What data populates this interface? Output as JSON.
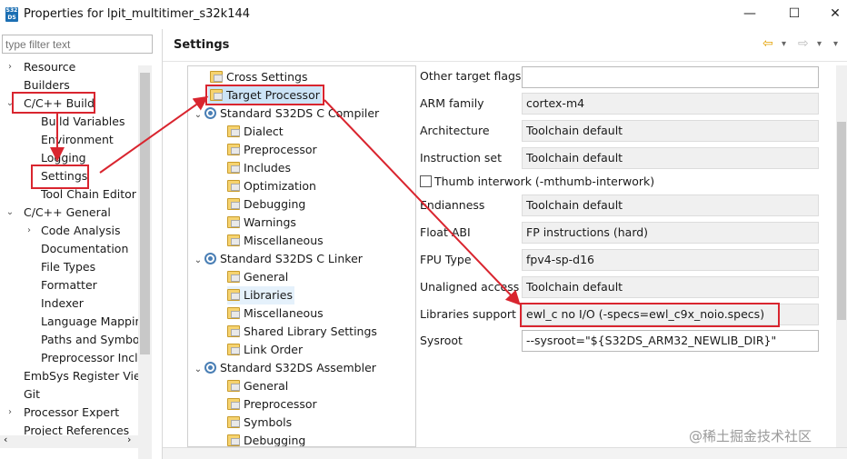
{
  "window": {
    "app_icon_text": "S32 DS",
    "title": "Properties for lpit_multitimer_s32k144",
    "minimize": "—",
    "maximize": "☐",
    "close": "✕"
  },
  "left": {
    "filter_placeholder": "type filter text",
    "items": [
      {
        "label": "Resource",
        "twisty": "›"
      },
      {
        "label": "Builders",
        "twisty": ""
      },
      {
        "label": "C/C++ Build",
        "twisty": "⌄"
      },
      {
        "label": "Build Variables",
        "twisty": ""
      },
      {
        "label": "Environment",
        "twisty": ""
      },
      {
        "label": "Logging",
        "twisty": ""
      },
      {
        "label": "Settings",
        "twisty": ""
      },
      {
        "label": "Tool Chain Editor",
        "twisty": ""
      },
      {
        "label": "C/C++ General",
        "twisty": "⌄"
      },
      {
        "label": "Code Analysis",
        "twisty": "›"
      },
      {
        "label": "Documentation",
        "twisty": ""
      },
      {
        "label": "File Types",
        "twisty": ""
      },
      {
        "label": "Formatter",
        "twisty": ""
      },
      {
        "label": "Indexer",
        "twisty": ""
      },
      {
        "label": "Language Mappin",
        "twisty": ""
      },
      {
        "label": "Paths and Symbols",
        "twisty": ""
      },
      {
        "label": "Preprocessor Inclu",
        "twisty": ""
      },
      {
        "label": "EmbSys Register View",
        "twisty": ""
      },
      {
        "label": "Git",
        "twisty": ""
      },
      {
        "label": "Processor Expert",
        "twisty": "›"
      },
      {
        "label": "Project References",
        "twisty": ""
      }
    ],
    "hscroll_left": "‹",
    "hscroll_right": "›"
  },
  "header": {
    "title": "Settings",
    "back": "⇦",
    "back_dd": "▾",
    "fwd": "⇨",
    "fwd_dd": "▾",
    "menu": "▾"
  },
  "tree": {
    "nodes": [
      {
        "label": "Cross Settings",
        "icon": "folder-settings-icon",
        "twisty": ""
      },
      {
        "label": "Target Processor",
        "icon": "folder-settings-icon",
        "twisty": ""
      },
      {
        "label": "Standard S32DS C Compiler",
        "icon": "tool-icon",
        "twisty": "⌄"
      },
      {
        "label": "Dialect",
        "icon": "folder-settings-icon",
        "twisty": ""
      },
      {
        "label": "Preprocessor",
        "icon": "folder-settings-icon",
        "twisty": ""
      },
      {
        "label": "Includes",
        "icon": "folder-settings-icon",
        "twisty": ""
      },
      {
        "label": "Optimization",
        "icon": "folder-settings-icon",
        "twisty": ""
      },
      {
        "label": "Debugging",
        "icon": "folder-settings-icon",
        "twisty": ""
      },
      {
        "label": "Warnings",
        "icon": "folder-settings-icon",
        "twisty": ""
      },
      {
        "label": "Miscellaneous",
        "icon": "folder-settings-icon",
        "twisty": ""
      },
      {
        "label": "Standard S32DS C Linker",
        "icon": "tool-icon",
        "twisty": "⌄"
      },
      {
        "label": "General",
        "icon": "folder-settings-icon",
        "twisty": ""
      },
      {
        "label": "Libraries",
        "icon": "folder-settings-icon",
        "twisty": ""
      },
      {
        "label": "Miscellaneous",
        "icon": "folder-settings-icon",
        "twisty": ""
      },
      {
        "label": "Shared Library Settings",
        "icon": "folder-settings-icon",
        "twisty": ""
      },
      {
        "label": "Link Order",
        "icon": "folder-settings-icon",
        "twisty": ""
      },
      {
        "label": "Standard S32DS Assembler",
        "icon": "tool-icon",
        "twisty": "⌄"
      },
      {
        "label": "General",
        "icon": "folder-settings-icon",
        "twisty": ""
      },
      {
        "label": "Preprocessor",
        "icon": "folder-settings-icon",
        "twisty": ""
      },
      {
        "label": "Symbols",
        "icon": "folder-settings-icon",
        "twisty": ""
      },
      {
        "label": "Debugging",
        "icon": "folder-settings-icon",
        "twisty": ""
      }
    ]
  },
  "form": {
    "other_target_flags": {
      "label": "Other target flags",
      "value": ""
    },
    "arm_family": {
      "label": "ARM family",
      "value": "cortex-m4"
    },
    "architecture": {
      "label": "Architecture",
      "value": "Toolchain default"
    },
    "instruction_set": {
      "label": "Instruction set",
      "value": "Toolchain default"
    },
    "thumb_interwork": {
      "label": "Thumb interwork (-mthumb-interwork)"
    },
    "endianness": {
      "label": "Endianness",
      "value": "Toolchain default"
    },
    "float_abi": {
      "label": "Float ABI",
      "value": "FP instructions (hard)"
    },
    "fpu_type": {
      "label": "FPU Type",
      "value": "fpv4-sp-d16"
    },
    "unaligned_access": {
      "label": "Unaligned access",
      "value": "Toolchain default"
    },
    "libraries_support": {
      "label": "Libraries support",
      "value": "ewl_c no I/O (-specs=ewl_c9x_noio.specs)"
    },
    "sysroot": {
      "label": "Sysroot",
      "value": "--sysroot=\"${S32DS_ARM32_NEWLIB_DIR}\""
    }
  },
  "watermark": "@稀土掘金技术社区",
  "colors": {
    "annotation": "#d9252f",
    "selection": "#cce4f7"
  }
}
